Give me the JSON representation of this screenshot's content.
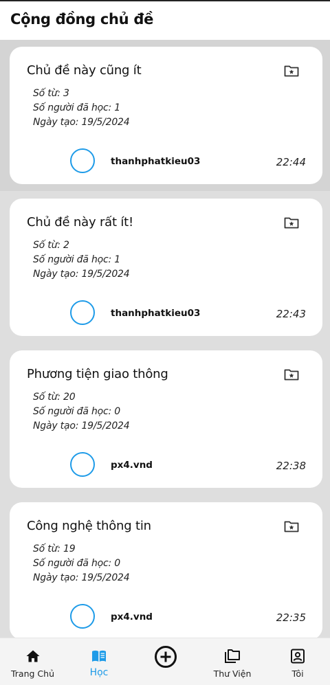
{
  "header": {
    "title": "Cộng đồng chủ đề"
  },
  "topics": [
    {
      "title": "Chủ đề này cũng ít",
      "words": "Số từ: 3",
      "learners": "Số người đã học: 1",
      "created": "Ngày tạo: 19/5/2024",
      "user": "thanhphatkieu03",
      "time": "22:44"
    },
    {
      "title": "Chủ đề này rất ít!",
      "words": "Số từ: 2",
      "learners": "Số người đã học: 1",
      "created": "Ngày tạo: 19/5/2024",
      "user": "thanhphatkieu03",
      "time": "22:43"
    },
    {
      "title": "Phương tiện giao thông",
      "words": "Số từ: 20",
      "learners": "Số người đã học: 0",
      "created": "Ngày tạo: 19/5/2024",
      "user": "px4.vnd",
      "time": "22:38"
    },
    {
      "title": "Công nghệ thông tin",
      "words": "Số từ: 19",
      "learners": "Số người đã học: 0",
      "created": "Ngày tạo: 19/5/2024",
      "user": "px4.vnd",
      "time": "22:35"
    }
  ],
  "nav": {
    "home": "Trang Chủ",
    "learn": "Học",
    "library": "Thư Viện",
    "me": "Tôi"
  },
  "colors": {
    "accent": "#1e9be8",
    "background": "#dedede",
    "card": "#ffffff"
  },
  "icons": {
    "home": "home-icon",
    "learn": "book-icon",
    "add": "plus-circle-icon",
    "library": "folders-icon",
    "me": "profile-icon",
    "save": "folder-star-icon"
  }
}
